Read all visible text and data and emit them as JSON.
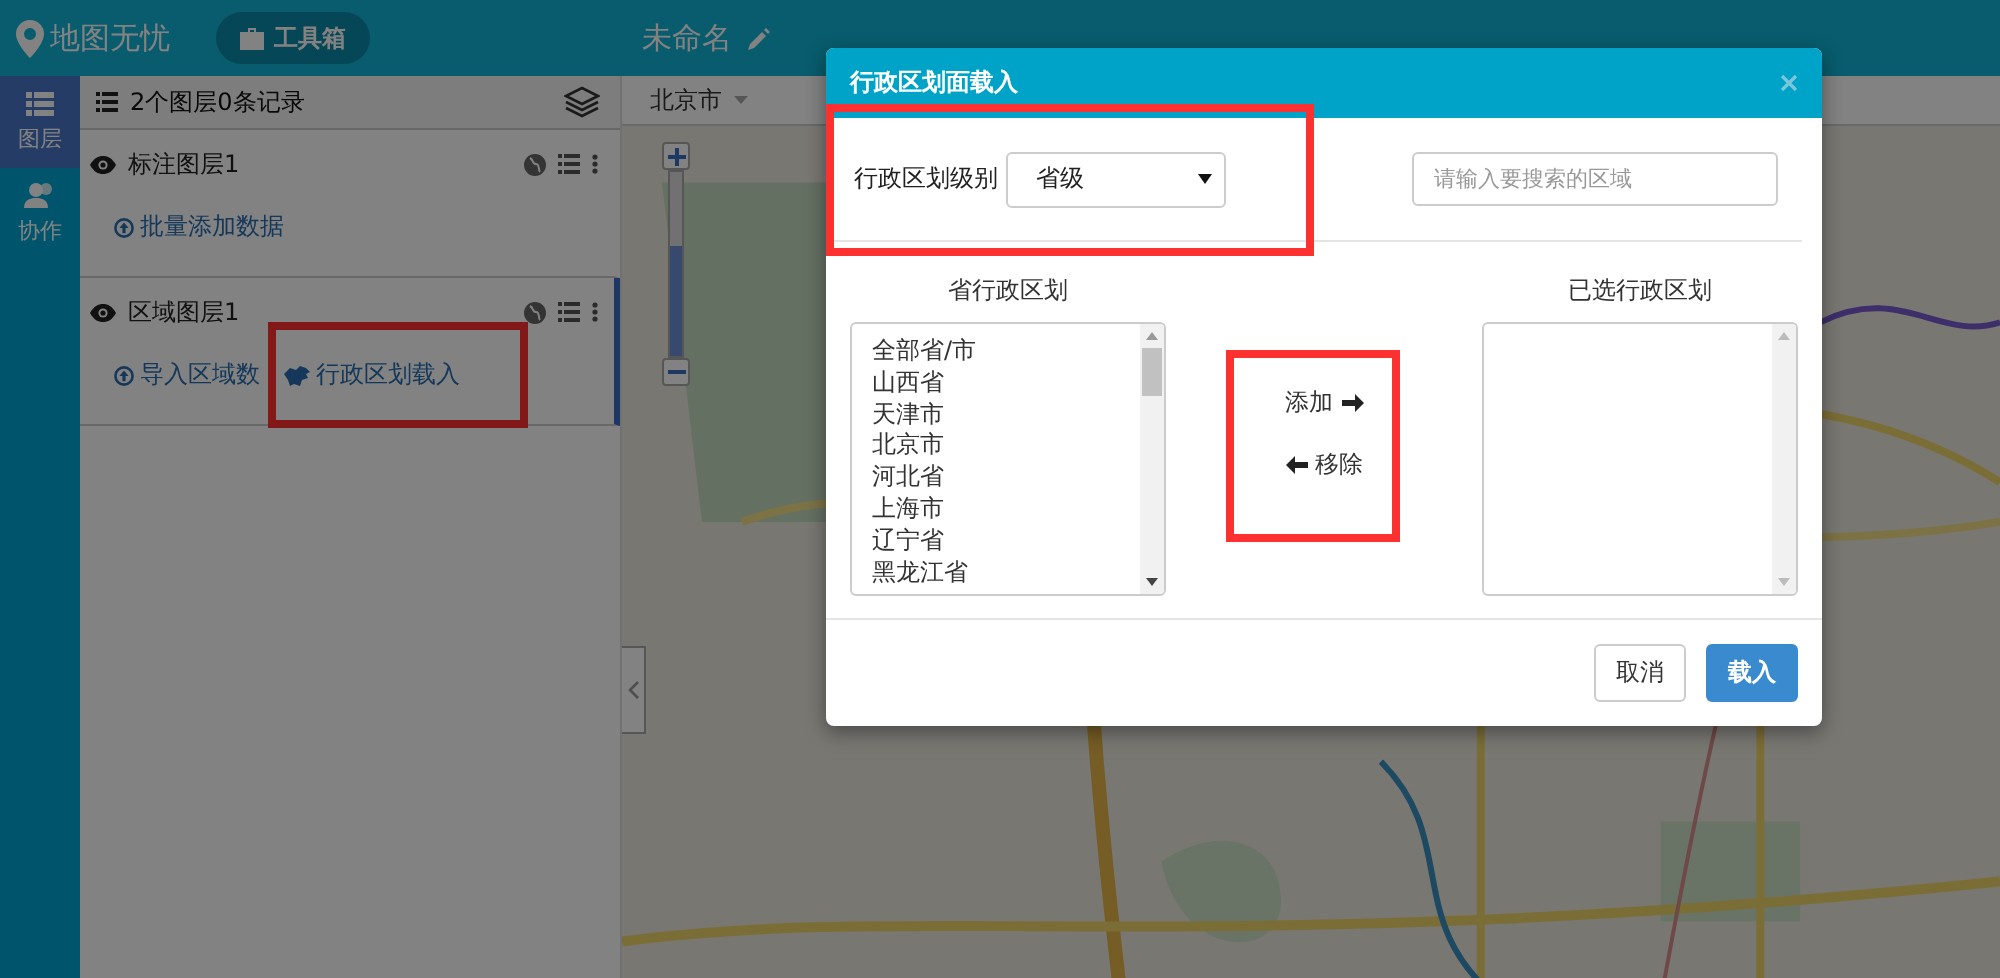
{
  "topbar": {
    "logo": "地图无忧",
    "toolbox_button": "工具箱",
    "map_title": "未命名"
  },
  "rail": [
    {
      "label": "图层",
      "kind": "layers",
      "selected": true
    },
    {
      "label": "协作",
      "kind": "people",
      "selected": false
    }
  ],
  "layers_panel": {
    "summary": "2个图层0条记录",
    "layers": [
      {
        "name": "标注图层1",
        "selected": false,
        "actions": [
          {
            "label": "批量添加数据",
            "kind": "upload",
            "highlighted": false
          }
        ]
      },
      {
        "name": "区域图层1",
        "selected": true,
        "actions": [
          {
            "label": "导入区域数",
            "kind": "upload",
            "highlighted": false
          },
          {
            "label": "行政区划载入",
            "kind": "china",
            "highlighted": true
          }
        ]
      }
    ]
  },
  "map": {
    "city": "北京市",
    "zoom": {
      "level": 0.6
    }
  },
  "dialog": {
    "title": "行政区划面载入",
    "level_label": "行政区划级别",
    "level_value": "省级",
    "level_highlighted": true,
    "search": {
      "placeholder": "请输入要搜索的区域"
    },
    "source_title": "省行政区划",
    "source_items": [
      "全部省/市",
      "山西省",
      "天津市",
      "北京市",
      "河北省",
      "上海市",
      "辽宁省",
      "黑龙江省"
    ],
    "target_title": "已选行政区划",
    "move_highlighted": true,
    "move_buttons": [
      {
        "label": "添加",
        "kind": "add"
      },
      {
        "label": "移除",
        "kind": "remove"
      }
    ],
    "buttons": [
      {
        "label": "取消",
        "kind": "default"
      },
      {
        "label": "载入",
        "kind": "primary"
      }
    ]
  }
}
